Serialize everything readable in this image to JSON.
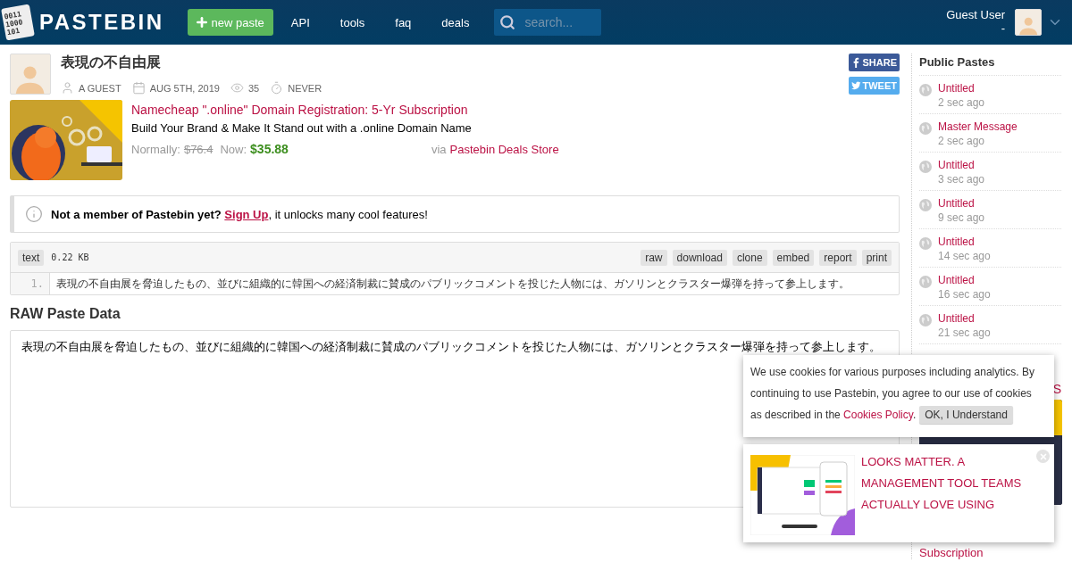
{
  "header": {
    "logo_digits": [
      "0011",
      "1000",
      "101"
    ],
    "logo_text": "PASTEBIN",
    "new_paste": "new paste",
    "nav": [
      "API",
      "tools",
      "faq",
      "deals"
    ],
    "search_placeholder": "search...",
    "user_name": "Guest User",
    "user_sub": "-"
  },
  "paste": {
    "title": "表現の不自由展",
    "meta": [
      {
        "kind": "user",
        "text": "A GUEST"
      },
      {
        "kind": "date",
        "text": "AUG 5TH, 2019"
      },
      {
        "kind": "views",
        "text": "35"
      },
      {
        "kind": "expiry",
        "text": "NEVER"
      }
    ],
    "share": [
      {
        "kind": "facebook",
        "label": "SHARE"
      },
      {
        "kind": "twitter",
        "label": "TWEET"
      }
    ]
  },
  "deal": {
    "title": "Namecheap \".online\" Domain Registration: 5-Yr Subscription",
    "subtitle": "Build Your Brand & Make It Stand out with a .online Domain Name",
    "normally_label": "Normally:",
    "old_price": "$76.4",
    "now_label": "Now:",
    "price": "$35.88",
    "via_label": "via",
    "store": "Pastebin Deals Store"
  },
  "notice": {
    "lead": "**Not a member of Pastebin yet?** ",
    "link": "Sign Up",
    "rest": ", it unlocks many cool features!"
  },
  "code": {
    "syntax": "text",
    "size": "0.22 KB",
    "actions": [
      "raw",
      "download",
      "clone",
      "embed",
      "report",
      "print"
    ],
    "lines": [
      {
        "number": "1.",
        "text": "表現の不自由展を脅迫したもの、並びに組織的に韓国への経済制裁に賛成のパブリックコメントを投じた人物には、ガソリンとクラスター爆弾を持って参上します。"
      }
    ]
  },
  "raw": {
    "heading": "RAW Paste Data",
    "text": "表現の不自由展を脅迫したもの、並びに組織的に韓国への経済制裁に賛成のパブリックコメントを投じた人物には、ガソリンとクラスター爆弾を持って参上します。"
  },
  "sidebar": {
    "heading": "Public Pastes",
    "pastes": [
      {
        "title": "Untitled",
        "time": "2 sec ago"
      },
      {
        "title": "Master Message",
        "time": "2 sec ago"
      },
      {
        "title": "Untitled",
        "time": "3 sec ago"
      },
      {
        "title": "Untitled",
        "time": "9 sec ago"
      },
      {
        "title": "Untitled",
        "time": "14 sec ago"
      },
      {
        "title": "Untitled",
        "time": "16 sec ago"
      },
      {
        "title": "Untitled",
        "time": "21 sec ago"
      }
    ],
    "ad_heading_fragment": "S",
    "ad_link": "Subscription"
  },
  "cookie": {
    "text": "We use cookies for various purposes including analytics. By continuing to use Pastebin, you agree to our use of cookies",
    "text_last_line": "as described in the ",
    "link": "Cookies Policy",
    "after": ".",
    "button": "OK, I Understand"
  },
  "popup_ad": {
    "text": "LOOKS MATTER. A MANAGEMENT TOOL TEAMS ACTUALLY LOVE USING"
  }
}
